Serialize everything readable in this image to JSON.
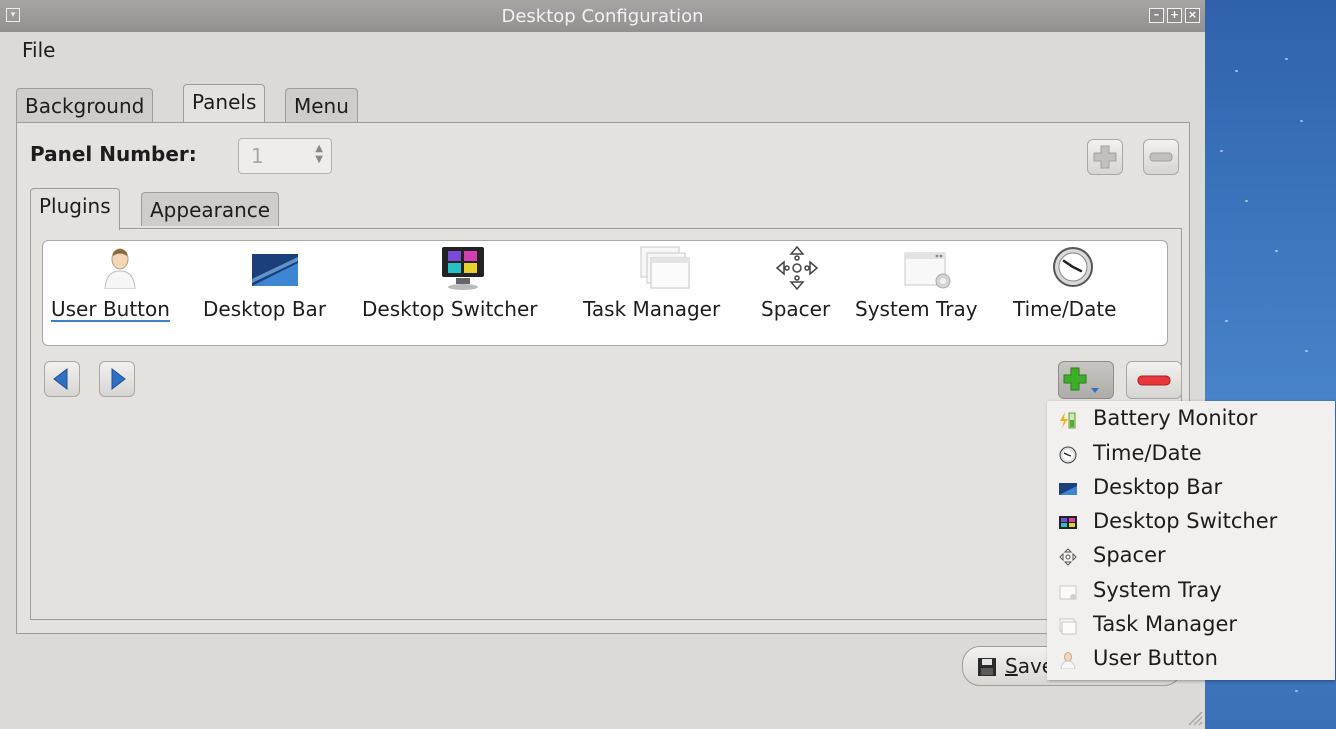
{
  "window": {
    "title": "Desktop Configuration",
    "wm_buttons": [
      "minimize",
      "maximize",
      "close"
    ]
  },
  "menubar": {
    "file": "File"
  },
  "top_tabs": [
    {
      "label": "Background",
      "active": false
    },
    {
      "label": "Panels",
      "active": true
    },
    {
      "label": "Menu",
      "active": false
    }
  ],
  "panel": {
    "number_label": "Panel Number:",
    "number_value": "1"
  },
  "sub_tabs": [
    {
      "label": "Plugins",
      "active": true
    },
    {
      "label": "Appearance",
      "active": false
    }
  ],
  "plugins": [
    {
      "label": "User Button",
      "icon": "user-icon",
      "selected": true
    },
    {
      "label": "Desktop Bar",
      "icon": "desktop-bar-icon",
      "selected": false
    },
    {
      "label": "Desktop Switcher",
      "icon": "desktop-switcher-icon",
      "selected": false
    },
    {
      "label": "Task Manager",
      "icon": "task-manager-icon",
      "selected": false
    },
    {
      "label": "Spacer",
      "icon": "spacer-icon",
      "selected": false
    },
    {
      "label": "System Tray",
      "icon": "system-tray-icon",
      "selected": false
    },
    {
      "label": "Time/Date",
      "icon": "clock-icon",
      "selected": false
    }
  ],
  "dropdown": [
    {
      "label": "Battery Monitor",
      "icon": "battery-icon"
    },
    {
      "label": "Time/Date",
      "icon": "clock-icon"
    },
    {
      "label": "Desktop Bar",
      "icon": "desktop-bar-icon"
    },
    {
      "label": "Desktop Switcher",
      "icon": "desktop-switcher-icon"
    },
    {
      "label": "Spacer",
      "icon": "spacer-icon"
    },
    {
      "label": "System Tray",
      "icon": "system-tray-icon"
    },
    {
      "label": "Task Manager",
      "icon": "task-manager-icon"
    },
    {
      "label": "User Button",
      "icon": "user-icon"
    }
  ],
  "save": {
    "label_prefix": "S",
    "label_rest": "ave"
  },
  "colors": {
    "selection_underline": "#3b83c9",
    "add_green": "#3eae2a",
    "remove_red": "#e8383b",
    "nav_blue": "#2f6fc4"
  }
}
